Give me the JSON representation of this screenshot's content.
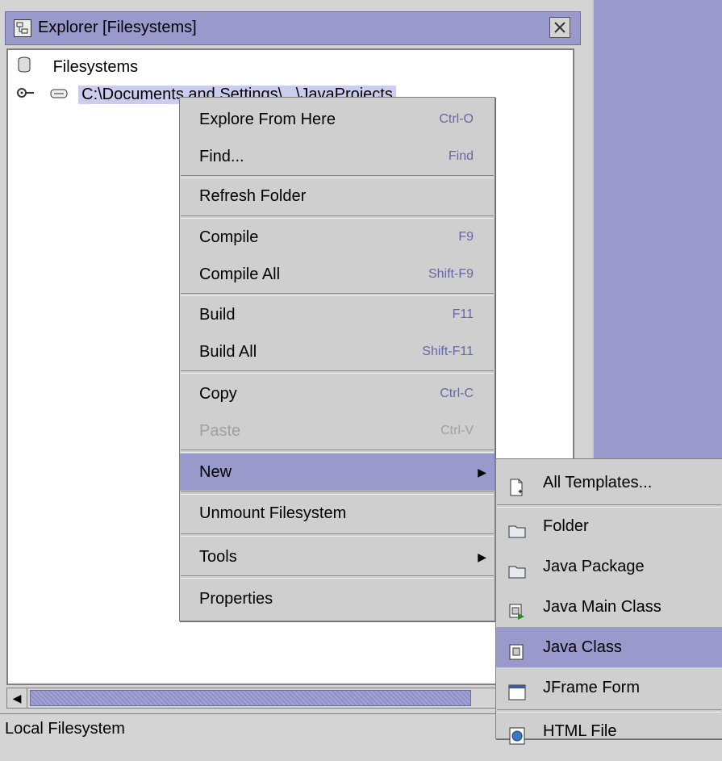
{
  "explorer": {
    "title": "Explorer [Filesystems]",
    "tree": {
      "root_label": "Filesystems",
      "mount_label": "C:\\Documents and Settings\\...\\JavaProjects"
    },
    "status_text": "Local Filesystem"
  },
  "context_menu": {
    "items": [
      {
        "label": "Explore From Here",
        "shortcut": "Ctrl-O"
      },
      {
        "label": "Find...",
        "shortcut": "Find"
      },
      {
        "label": "Refresh Folder",
        "shortcut": ""
      },
      {
        "label": "Compile",
        "shortcut": "F9"
      },
      {
        "label": "Compile All",
        "shortcut": "Shift-F9"
      },
      {
        "label": "Build",
        "shortcut": "F11"
      },
      {
        "label": "Build All",
        "shortcut": "Shift-F11"
      },
      {
        "label": "Copy",
        "shortcut": "Ctrl-C"
      },
      {
        "label": "Paste",
        "shortcut": "Ctrl-V"
      },
      {
        "label": "New",
        "shortcut": ""
      },
      {
        "label": "Unmount Filesystem",
        "shortcut": ""
      },
      {
        "label": "Tools",
        "shortcut": ""
      },
      {
        "label": "Properties",
        "shortcut": ""
      }
    ]
  },
  "new_submenu": {
    "items": [
      {
        "label": "All Templates...",
        "icon": "template-icon"
      },
      {
        "label": "Folder",
        "icon": "folder-icon"
      },
      {
        "label": "Java Package",
        "icon": "package-icon"
      },
      {
        "label": "Java Main Class",
        "icon": "main-class-icon"
      },
      {
        "label": "Java Class",
        "icon": "class-icon"
      },
      {
        "label": "JFrame Form",
        "icon": "jframe-icon"
      },
      {
        "label": "HTML File",
        "icon": "html-icon"
      }
    ]
  },
  "colors": {
    "selection": "#9999cc",
    "menu_bg": "#cfcfcf",
    "shortcut_text": "#6666aa"
  }
}
